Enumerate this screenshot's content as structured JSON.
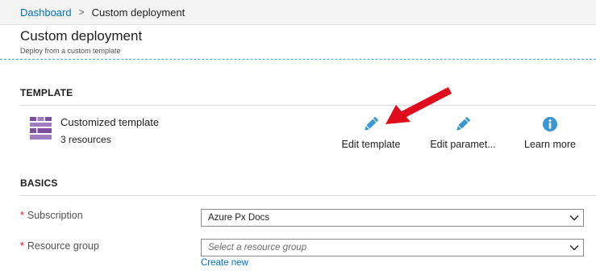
{
  "breadcrumb": {
    "root": "Dashboard",
    "separator": ">",
    "current": "Custom deployment"
  },
  "header": {
    "title": "Custom deployment",
    "subtitle": "Deploy from a custom template"
  },
  "template_section": {
    "heading": "TEMPLATE",
    "item": {
      "name": "Customized template",
      "resources": "3 resources",
      "icon": "template-grid-icon",
      "icon_color": "#7b4f9e"
    },
    "actions": [
      {
        "label": "Edit template",
        "icon": "pencil-icon"
      },
      {
        "label": "Edit paramet...",
        "icon": "pencil-icon"
      },
      {
        "label": "Learn more",
        "icon": "info-icon"
      }
    ],
    "action_icon_color": "#3b97d3",
    "annotation_arrow_color": "#e00b1c"
  },
  "basics_section": {
    "heading": "BASICS",
    "subscription": {
      "label": "Subscription",
      "value": "Azure Px Docs"
    },
    "resource_group": {
      "label": "Resource group",
      "placeholder": "Select a resource group",
      "create_link": "Create new"
    },
    "required_marker": "*"
  },
  "colors": {
    "link": "#0072c6",
    "required": "#e00b1c",
    "header_rule": "#4fa3d9"
  }
}
